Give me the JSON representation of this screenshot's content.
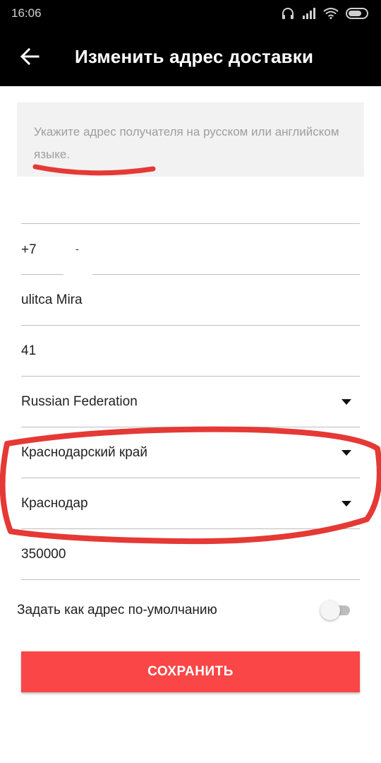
{
  "status_bar": {
    "time": "16:06"
  },
  "app_bar": {
    "title": "Изменить адрес доставки"
  },
  "hint": {
    "text": "Укажите адрес получателя на русском или английском языке."
  },
  "form": {
    "name_value": "",
    "phone_code": "+7",
    "phone_number": "-",
    "street": "ulitca Mira",
    "house": "41",
    "country": "Russian Federation",
    "region": "Краснодарский край",
    "city": "Краснодар",
    "postal_code": "350000"
  },
  "default_toggle": {
    "label": "Задать как адрес по-умолчанию",
    "on": false
  },
  "save_button": {
    "label": "СОХРАНИТЬ"
  },
  "colors": {
    "accent": "#fa4646",
    "appbar": "#000000",
    "hint_bg": "#f2f2f2",
    "annotation": "#e53935"
  }
}
